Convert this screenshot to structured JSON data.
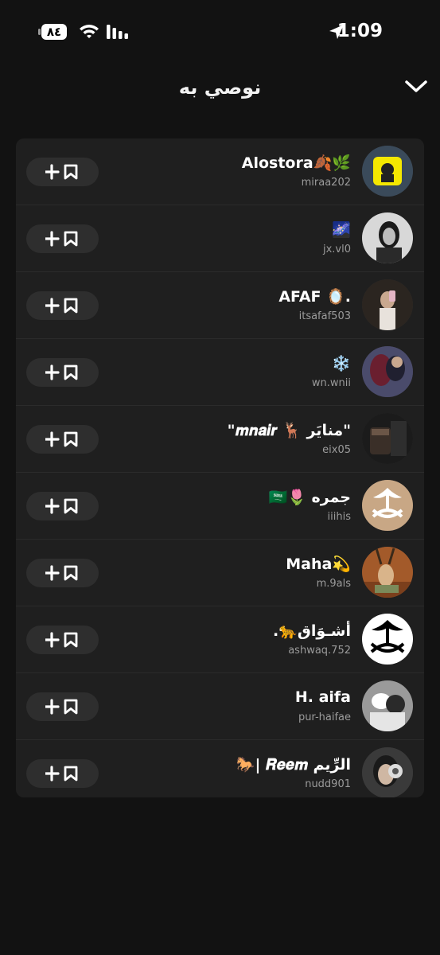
{
  "status_bar": {
    "battery": "٨٤",
    "time": "1:09"
  },
  "header": {
    "title": "نوصي به"
  },
  "suggestions": [
    {
      "name": "Alostora🍂🌿",
      "username": "miraa202",
      "avatar": "snapcode-avatar"
    },
    {
      "name": "🌌",
      "username": "jx.vl0",
      "avatar": "photo-avatar"
    },
    {
      "name": "AFAF 🪞.",
      "username": "itsafaf503",
      "avatar": "photo-avatar"
    },
    {
      "name": "❄️",
      "username": "wn.wnii",
      "avatar": "photo-avatar"
    },
    {
      "name": "\"𝒎𝒏𝒂𝒊𝒓 🦌 منايَر\"",
      "username": "eix05",
      "avatar": "photo-avatar"
    },
    {
      "name": "🇸🇦🌷 جمره",
      "username": "iiihis",
      "avatar": "emblem-avatar"
    },
    {
      "name": "Maha💫",
      "username": "m.9als",
      "avatar": "photo-avatar"
    },
    {
      "name": ".🐆أشـوَاق",
      "username": "ashwaq.752",
      "avatar": "emblem-avatar"
    },
    {
      "name": "H. aifa",
      "username": "pur-haifae",
      "avatar": "photo-avatar"
    },
    {
      "name": "🐎| 𝑹𝒆𝒆𝒎 الرِّيم",
      "username": "nudd901",
      "avatar": "photo-avatar"
    }
  ],
  "icons": {
    "add_button": "plus-bookmark-icon",
    "header_close": "chevron-down-icon"
  }
}
